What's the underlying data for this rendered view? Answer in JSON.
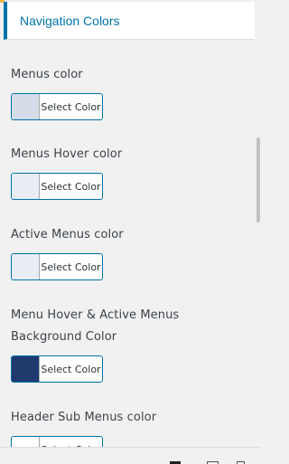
{
  "colors": {
    "accent": "#0073aa",
    "corner_accent": "#f0b849"
  },
  "section": {
    "title": "Navigation Colors"
  },
  "controls": [
    {
      "label": "Menus color",
      "button_text": "Select Color",
      "swatch": "#d5dde8"
    },
    {
      "label": "Menus Hover color",
      "button_text": "Select Color",
      "swatch": "#e9eef4"
    },
    {
      "label": "Active Menus color",
      "button_text": "Select Color",
      "swatch": "#e9eef4"
    },
    {
      "label_line1": "Menu Hover & Active Menus",
      "label_line2": "Background Color",
      "button_text": "Select Color",
      "swatch": "#213a6e"
    },
    {
      "label": "Header Sub Menus color",
      "button_text": "Select Color",
      "swatch": "#ffffff"
    }
  ],
  "footer": {
    "device_icons": [
      "desktop-icon",
      "tablet-icon",
      "mobile-icon"
    ]
  }
}
